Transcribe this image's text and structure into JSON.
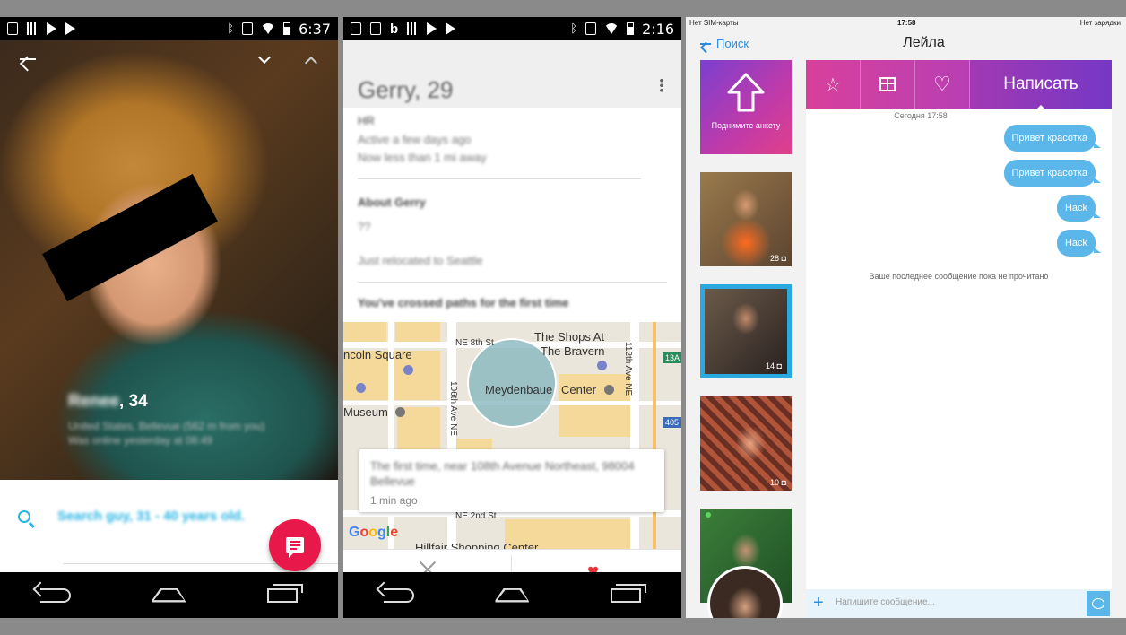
{
  "panel1": {
    "status_time": "6:37",
    "profile_name": "Renee",
    "profile_age": ", 34",
    "meta_line1": "United States, Bellevue (562 m from you)",
    "meta_line2": "Was online yesterday at 08:49",
    "search_text": "Search guy, 31 - 40 years old."
  },
  "panel2": {
    "status_time": "2:16",
    "title_name": "Gerry",
    "title_age": ", 29",
    "occupation": "HR",
    "active": "Active a few days ago",
    "distance": "Now less than 1 mi away",
    "about_label": "About Gerry",
    "about_q": "??",
    "about_text": "Just relocated to Seattle",
    "crossed": "You've crossed paths for the first time",
    "map": {
      "labels": [
        "NE 8th St",
        "The Shops At",
        "The Bravern",
        "ncoln Square",
        "Meydenbaue",
        "Center",
        "Museum",
        "106th Ave NE",
        "112th Ave NE",
        "NE 2nd St",
        "Hillfair Shopping Center"
      ],
      "badges": [
        "13A",
        "405"
      ],
      "logo": "Google"
    },
    "card_text": "The first time, near 108th Avenue Northeast, 98004 Bellevue",
    "card_time": "1 min ago"
  },
  "panel3": {
    "carrier": "Нет SIM-карты",
    "time": "17:58",
    "charging": "Нет зарядки",
    "back_label": "Поиск",
    "title": "Лейла",
    "boost_label": "Поднимите анкету",
    "thumbs": [
      {
        "count": "28"
      },
      {
        "count": "14"
      },
      {
        "count": "10"
      },
      {
        "count": ""
      }
    ],
    "write_label": "Написать",
    "date_label": "Сегодня 17:58",
    "messages": [
      "Привет красотка",
      "Привет красотка",
      "Hack",
      "Hack"
    ],
    "unread_note": "Ваше последнее сообщение пока не прочитано",
    "compose_placeholder": "Напишите сообщение..."
  },
  "colors": {
    "accent_blue": "#27b4e3",
    "fab_red": "#e8194a",
    "bubble_blue": "#5bb6ea",
    "gradient_pink": "#d8409b",
    "gradient_purple": "#7e3ecb"
  }
}
